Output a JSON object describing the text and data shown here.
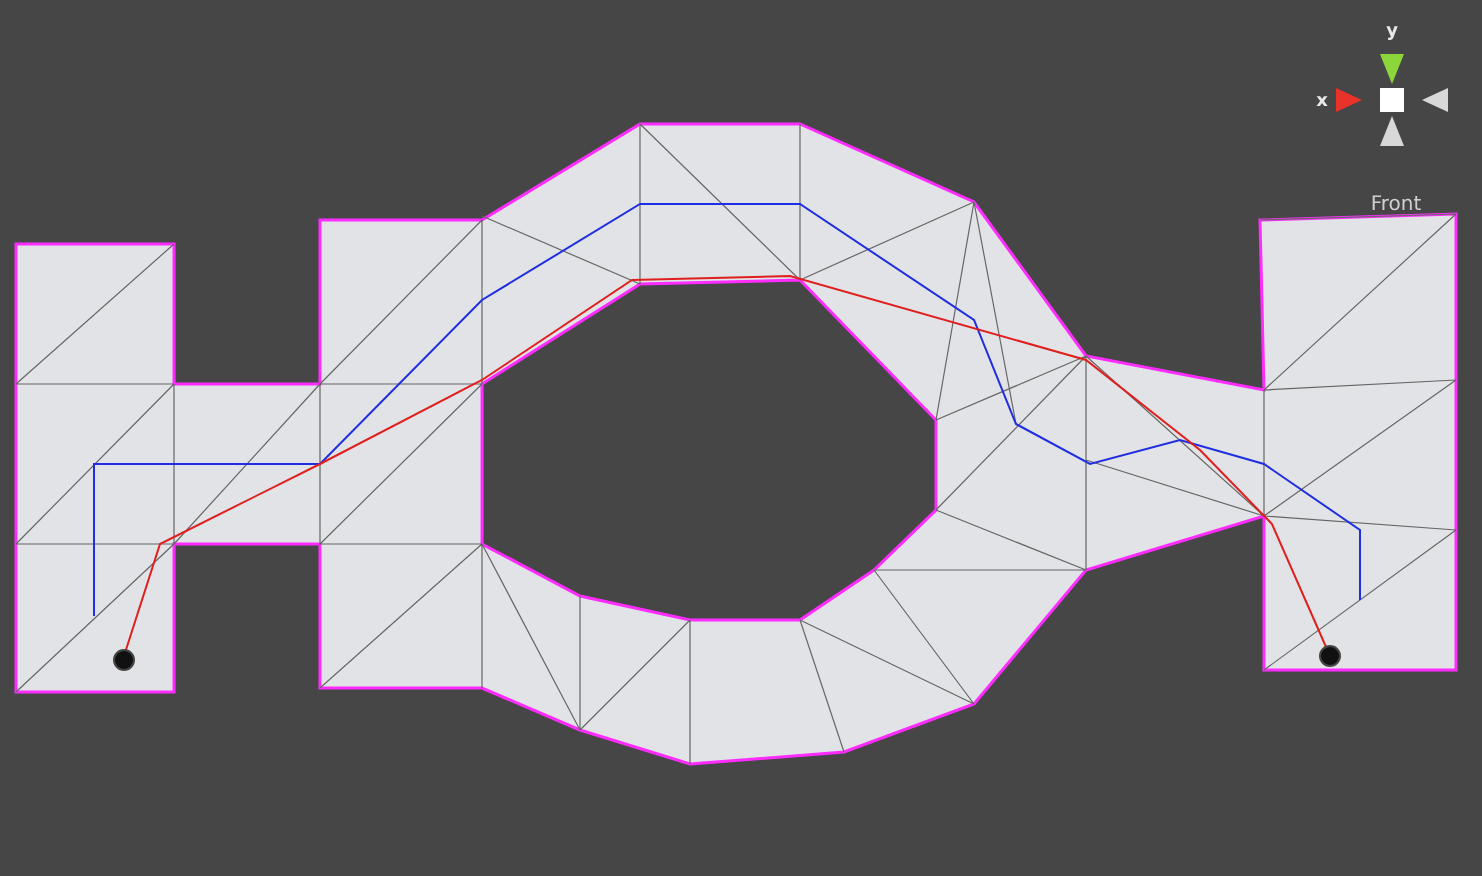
{
  "scene_view": {
    "view_label": "Front",
    "gizmo": {
      "axes": [
        {
          "label": "y",
          "color": "#8cd63c",
          "kind": "up"
        },
        {
          "label": "x",
          "color": "#e8322a",
          "kind": "left"
        }
      ]
    }
  }
}
